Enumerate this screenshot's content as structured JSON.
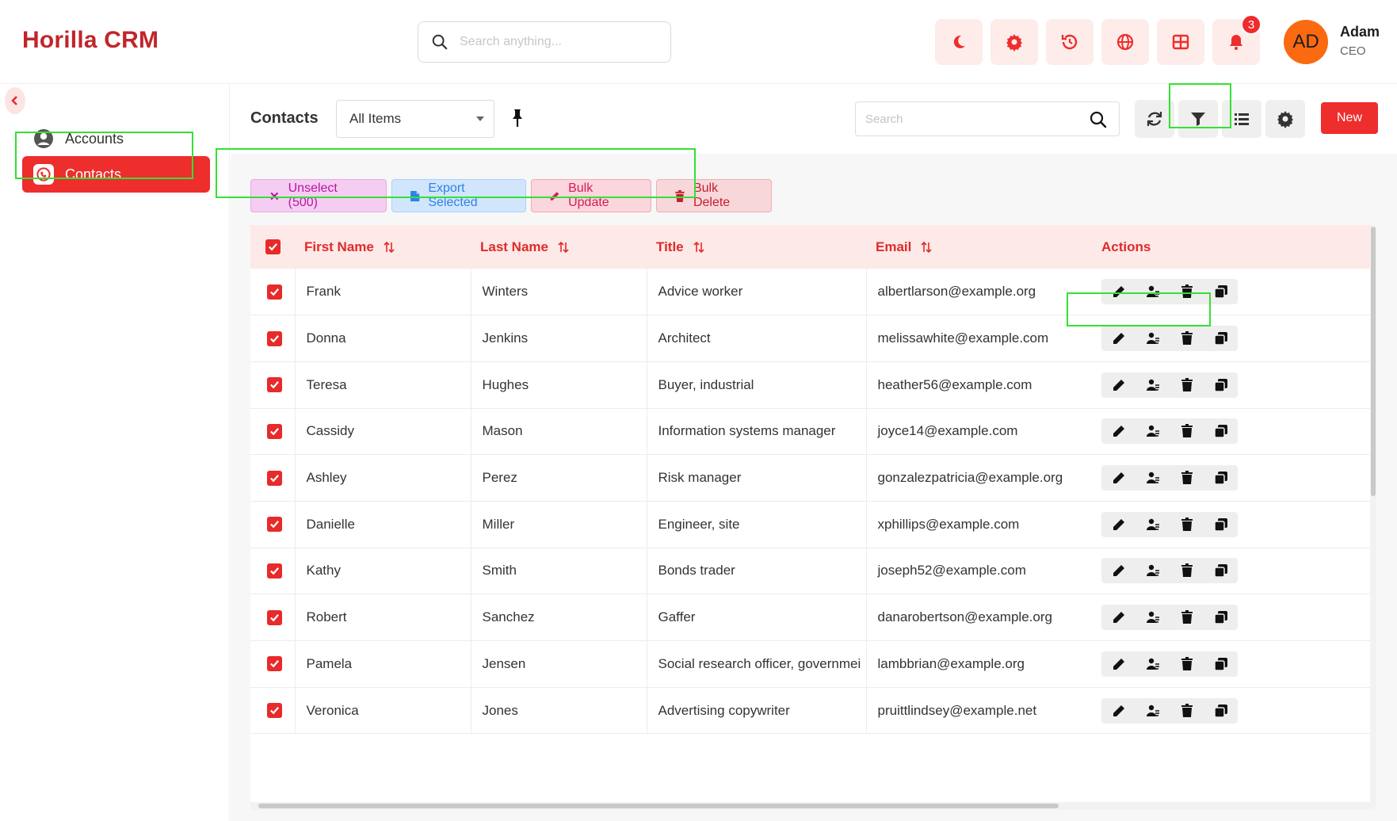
{
  "app": {
    "brand": "Horilla CRM",
    "search_placeholder": "Search anything...",
    "notifications_count": "3",
    "user": {
      "initials": "AD",
      "name": "Adam",
      "role": "CEO"
    },
    "colors": {
      "brand": "#c0262c",
      "accent": "#ee2d2d",
      "avatar": "#fb6a10"
    }
  },
  "topbar_icons": [
    "moon-icon",
    "gear-icon",
    "history-icon",
    "globe-icon",
    "grid-icon",
    "bell-icon"
  ],
  "sidebar": {
    "items": [
      {
        "label": "Accounts",
        "icon": "account-icon",
        "active": false
      },
      {
        "label": "Contacts",
        "icon": "contact-icon",
        "active": true
      }
    ]
  },
  "page": {
    "title": "Contacts",
    "view_select": "All Items",
    "search_placeholder": "Search",
    "new_label": "New"
  },
  "bulk": {
    "unselect": "Unselect (500)",
    "export": "Export Selected",
    "update": "Bulk Update",
    "delete": "Bulk Delete"
  },
  "table": {
    "columns": [
      "First Name",
      "Last Name",
      "Title",
      "Email",
      "Actions"
    ],
    "rows": [
      {
        "first": "Frank",
        "last": "Winters",
        "title": "Advice worker",
        "email": "albertlarson@example.org"
      },
      {
        "first": "Donna",
        "last": "Jenkins",
        "title": "Architect",
        "email": "melissawhite@example.com"
      },
      {
        "first": "Teresa",
        "last": "Hughes",
        "title": "Buyer, industrial",
        "email": "heather56@example.com"
      },
      {
        "first": "Cassidy",
        "last": "Mason",
        "title": "Information systems manager",
        "email": "joyce14@example.com"
      },
      {
        "first": "Ashley",
        "last": "Perez",
        "title": "Risk manager",
        "email": "gonzalezpatricia@example.org"
      },
      {
        "first": "Danielle",
        "last": "Miller",
        "title": "Engineer, site",
        "email": "xphillips@example.com"
      },
      {
        "first": "Kathy",
        "last": "Smith",
        "title": "Bonds trader",
        "email": "joseph52@example.com"
      },
      {
        "first": "Robert",
        "last": "Sanchez",
        "title": "Gaffer",
        "email": "danarobertson@example.org"
      },
      {
        "first": "Pamela",
        "last": "Jensen",
        "title": "Social research officer, governmei",
        "email": "lambbrian@example.org"
      },
      {
        "first": "Veronica",
        "last": "Jones",
        "title": "Advertising copywriter",
        "email": "pruittlindsey@example.net"
      }
    ]
  }
}
